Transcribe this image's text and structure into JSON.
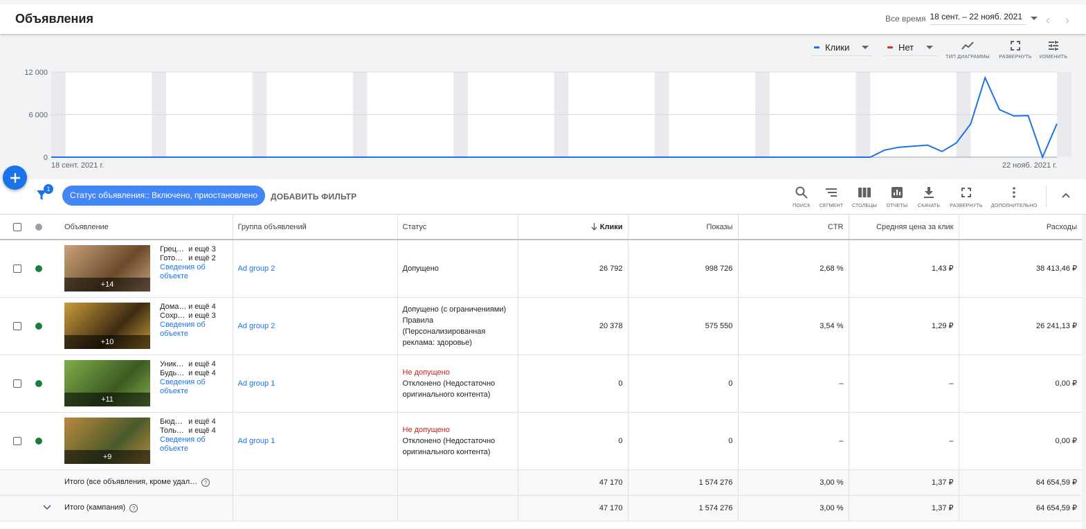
{
  "header": {
    "title": "Объявления",
    "range_label": "Все время",
    "range_value": "18 сент. – 22 нояб. 2021"
  },
  "chart_controls": {
    "metric1": "Клики",
    "metric1_color": "#1a73e8",
    "metric2": "Нет",
    "metric2_color": "#d93025",
    "chart_type": "ТИП ДИАГРАММЫ",
    "expand": "РАЗВЕРНУТЬ",
    "change": "ИЗМЕНИТЬ"
  },
  "chart_data": {
    "type": "line",
    "x_start_label": "18 сент. 2021 г.",
    "x_end_label": "22 нояб. 2021 г.",
    "y_ticks": [
      "12 000",
      "6 000",
      "0"
    ],
    "ylim": [
      0,
      12000
    ],
    "grid": true,
    "series": [
      {
        "color": "#1a73e8",
        "values": [
          0,
          0,
          0,
          0,
          0,
          0,
          0,
          0,
          0,
          0,
          0,
          0,
          0,
          0,
          0,
          0,
          0,
          0,
          0,
          0,
          0,
          0,
          0,
          0,
          0,
          0,
          0,
          0,
          0,
          0,
          0,
          0,
          0,
          0,
          0,
          0,
          0,
          0,
          0,
          0,
          0,
          0,
          0,
          0,
          0,
          0,
          0,
          0,
          0,
          0,
          0,
          0,
          0,
          0,
          0,
          0,
          0,
          0,
          1000,
          1400,
          1550,
          1700,
          800,
          2000,
          4700,
          11200,
          6700,
          5800,
          5850,
          0,
          4700
        ]
      }
    ]
  },
  "filters": {
    "badge": "1",
    "chip": "Статус объявления:: Включено, приостановлено",
    "add_filter": "ДОБАВИТЬ ФИЛЬТР"
  },
  "toolbar": {
    "search": "ПОИСК",
    "segment": "СЕГМЕНТ",
    "columns": "СТОЛБЦЫ",
    "reports": "ОТЧЕТЫ",
    "download": "СКАЧАТЬ",
    "expand": "РАЗВЕРНУТЬ",
    "more": "ДОПОЛНИТЕЛЬНО"
  },
  "table": {
    "headers": {
      "ad": "Объявление",
      "group": "Группа объявлений",
      "status": "Статус",
      "clicks": "Клики",
      "impressions": "Показы",
      "ctr": "CTR",
      "cpc": "Средняя цена за клик",
      "cost": "Расходы"
    },
    "rows": [
      {
        "thumb_count": "+14",
        "h1": "Грец…",
        "h1_more": "и ещё 3",
        "h2": "Гото…",
        "h2_more": "и ещё 2",
        "link1": "Сведения об",
        "link2": "объекте",
        "group": "Ad group 2",
        "status_title": "",
        "status": "Допущено",
        "clicks": "26 792",
        "impressions": "998 726",
        "ctr": "2,68 %",
        "cpc": "1,43 ₽",
        "cost": "38 413,46 ₽",
        "img_a": "#c9a27a",
        "img_b": "#6b4a2b"
      },
      {
        "thumb_count": "+10",
        "h1": "Дома…",
        "h1_more": "и ещё 4",
        "h2": "Сохр…",
        "h2_more": "и ещё 3",
        "link1": "Сведения об",
        "link2": "объекте",
        "group": "Ad group 2",
        "status_title": "",
        "status": "Допущено (с ограничениями) Правила (Персонализированная реклама: здоровье)",
        "clicks": "20 378",
        "impressions": "575 550",
        "ctr": "3,54 %",
        "cpc": "1,29 ₽",
        "cost": "26 241,13 ₽",
        "img_a": "#c89b3c",
        "img_b": "#3d2b12"
      },
      {
        "thumb_count": "+11",
        "h1": "Уник…",
        "h1_more": "и ещё 4",
        "h2": "Будь…",
        "h2_more": "и ещё 4",
        "link1": "Сведения об",
        "link2": "объекте",
        "group": "Ad group 1",
        "status_title": "Не допущено",
        "status": "Отклонено (Недостаточно оригинального контента)",
        "clicks": "0",
        "impressions": "0",
        "ctr": "–",
        "cpc": "–",
        "cost": "0,00 ₽",
        "img_a": "#7fae4a",
        "img_b": "#3b5a22"
      },
      {
        "thumb_count": "+9",
        "h1": "Бюд…",
        "h1_more": "и ещё 4",
        "h2": "Толь…",
        "h2_more": "и ещё 4",
        "link1": "Сведения об",
        "link2": "объекте",
        "group": "Ad group 1",
        "status_title": "Не допущено",
        "status": "Отклонено (Недостаточно оригинального контента)",
        "clicks": "0",
        "impressions": "0",
        "ctr": "–",
        "cpc": "–",
        "cost": "0,00 ₽",
        "img_a": "#b98a3e",
        "img_b": "#4a5a2a"
      }
    ],
    "totals": [
      {
        "label": "Итого (все объявления, кроме удал…",
        "clicks": "47 170",
        "impressions": "1 574 276",
        "ctr": "3,00 %",
        "cpc": "1,37 ₽",
        "cost": "64 654,59 ₽"
      },
      {
        "label": "Итого (кампания)",
        "clicks": "47 170",
        "impressions": "1 574 276",
        "ctr": "3,00 %",
        "cpc": "1,37 ₽",
        "cost": "64 654,59 ₽"
      }
    ],
    "status_dot_color": "#188038"
  }
}
